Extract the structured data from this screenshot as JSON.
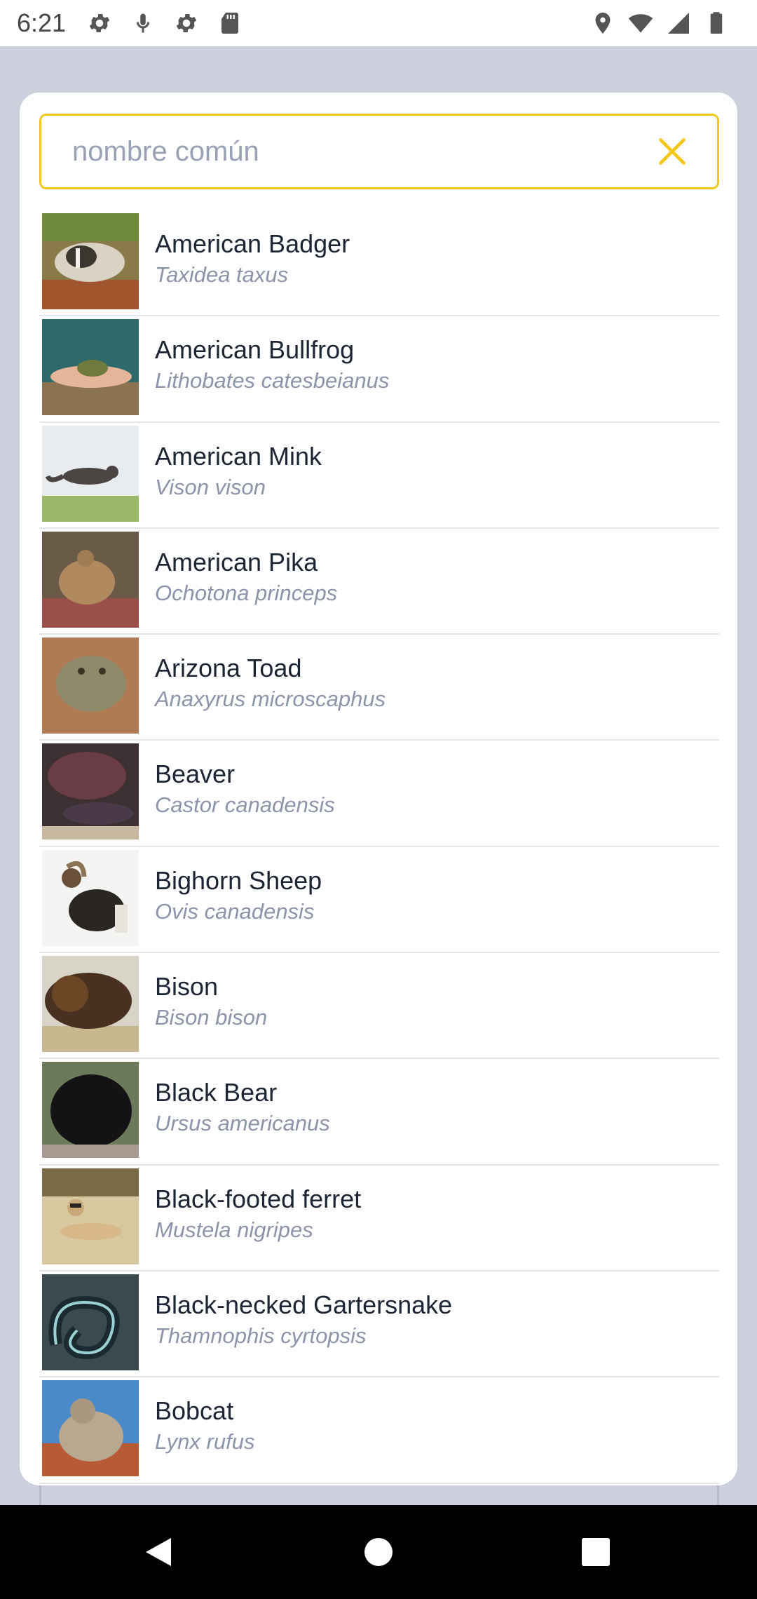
{
  "status_bar": {
    "time": "6:21",
    "left_icons": [
      "gear-icon",
      "mic-icon",
      "gear-icon",
      "sd-card-icon"
    ],
    "right_icons": [
      "location-icon",
      "wifi-icon",
      "signal-icon",
      "battery-icon"
    ]
  },
  "search": {
    "placeholder": "nombre común",
    "value": "",
    "clear_icon": "close-icon",
    "accent_color": "#f2c81a"
  },
  "species": [
    {
      "common": "American Badger",
      "scientific": "Taxidea taxus"
    },
    {
      "common": "American Bullfrog",
      "scientific": "Lithobates catesbeianus"
    },
    {
      "common": "American Mink",
      "scientific": "Vison vison"
    },
    {
      "common": "American Pika",
      "scientific": "Ochotona princeps"
    },
    {
      "common": "Arizona Toad",
      "scientific": "Anaxyrus microscaphus"
    },
    {
      "common": "Beaver",
      "scientific": "Castor canadensis"
    },
    {
      "common": "Bighorn Sheep",
      "scientific": "Ovis canadensis"
    },
    {
      "common": "Bison",
      "scientific": "Bison bison"
    },
    {
      "common": "Black Bear",
      "scientific": "Ursus americanus"
    },
    {
      "common": "Black-footed ferret",
      "scientific": "Mustela nigripes"
    },
    {
      "common": "Black-necked Gartersnake",
      "scientific": "Thamnophis cyrtopsis"
    },
    {
      "common": "Bobcat",
      "scientific": "Lynx rufus"
    }
  ],
  "nav_bar": {
    "buttons": [
      "back-icon",
      "home-icon",
      "recents-icon"
    ]
  }
}
